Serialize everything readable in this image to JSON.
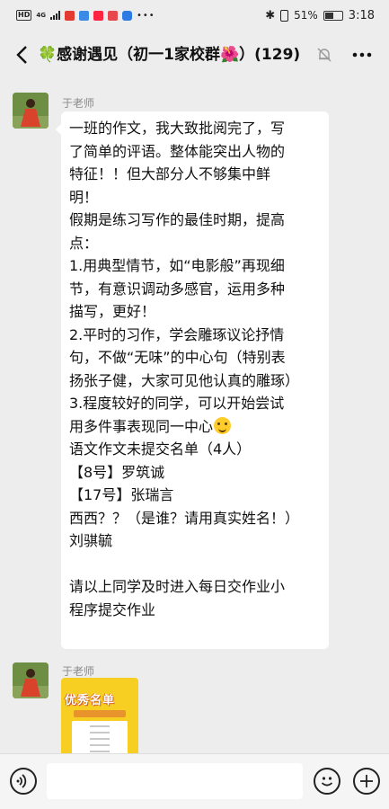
{
  "status_bar": {
    "left_text": "HD",
    "network": "4G",
    "battery_percent": "51%",
    "battery_level": 0.51,
    "time": "3:18",
    "icons": [
      "hd-icon",
      "signal-icon",
      "app-icon-tmall",
      "app-icon-kuaikan",
      "app-icon-red",
      "app-icon-video",
      "app-icon-alipay",
      "more-dots-icon",
      "bluetooth-icon",
      "vibrate-icon",
      "battery-icon"
    ]
  },
  "header": {
    "title": "🍀感谢遇见（初一1家校群🌺）(129)",
    "icons": [
      "back-arrow-icon",
      "mute-bell-icon",
      "more-menu-icon"
    ]
  },
  "messages": [
    {
      "sender": "于老师",
      "lines": [
        "一班的作文，我大致批阅完了，写",
        "了简单的评语。整体能突出人物的",
        "特征！！但大部分人不够集中鲜",
        "明！",
        "假期是练习写作的最佳时期，提高",
        "点：",
        "1.用典型情节，如“电影般”再现细",
        "节，有意识调动多感官，运用多种",
        "描写，更好！",
        "2.平时的习作，学会雕琢议论抒情",
        "句，不做“无味”的中心句（特别表",
        "扬张子健，大家可见他认真的雕琢）",
        "3.程度较好的同学，可以开始尝试",
        "用多件事表现同一中心",
        "语文作文未提交名单（4人）",
        "【8号】罗筑诚",
        "【17号】张瑞言",
        "西西？？（是谁？请用真实姓名！）",
        "刘骐毓",
        "",
        "请以上同学及时进入每日交作业小",
        "程序提交作业"
      ],
      "emoji_after_line": 13,
      "emoji_name": "smiling-face-emoji"
    },
    {
      "sender": "于老师",
      "image": {
        "title": "优秀名单"
      }
    }
  ],
  "input_bar": {
    "placeholder": "",
    "icons": [
      "voice-icon",
      "emoji-icon",
      "plus-icon"
    ]
  },
  "colors": {
    "background": "#ededed",
    "bubble": "#ffffff",
    "poster": "#f6cf22",
    "sender_name": "#8a8a8a"
  }
}
